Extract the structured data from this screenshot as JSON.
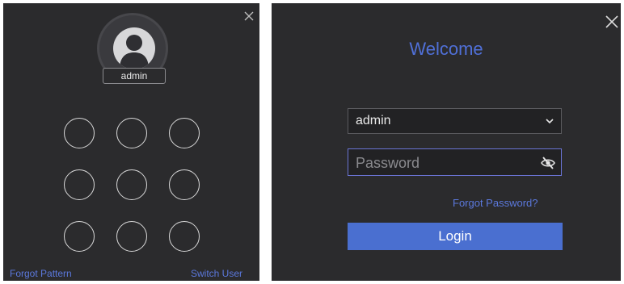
{
  "pattern_panel": {
    "username": "admin",
    "close_icon": "close-icon",
    "avatar_icon": "user-avatar-icon",
    "dot_count": 9,
    "forgot_pattern_label": "Forgot Pattern",
    "switch_user_label": "Switch User"
  },
  "login_panel": {
    "title": "Welcome",
    "close_icon": "close-icon",
    "username_select": {
      "value": "admin",
      "icon": "chevron-down-icon"
    },
    "password": {
      "placeholder": "Password",
      "value": "",
      "icon": "eye-off-icon"
    },
    "forgot_password_label": "Forgot Password?",
    "login_label": "Login"
  },
  "colors": {
    "panel_bg": "#2b2b2d",
    "accent": "#5070d8",
    "button_bg": "#4a6fd0",
    "pattern_dot": "#d8d8d8"
  }
}
